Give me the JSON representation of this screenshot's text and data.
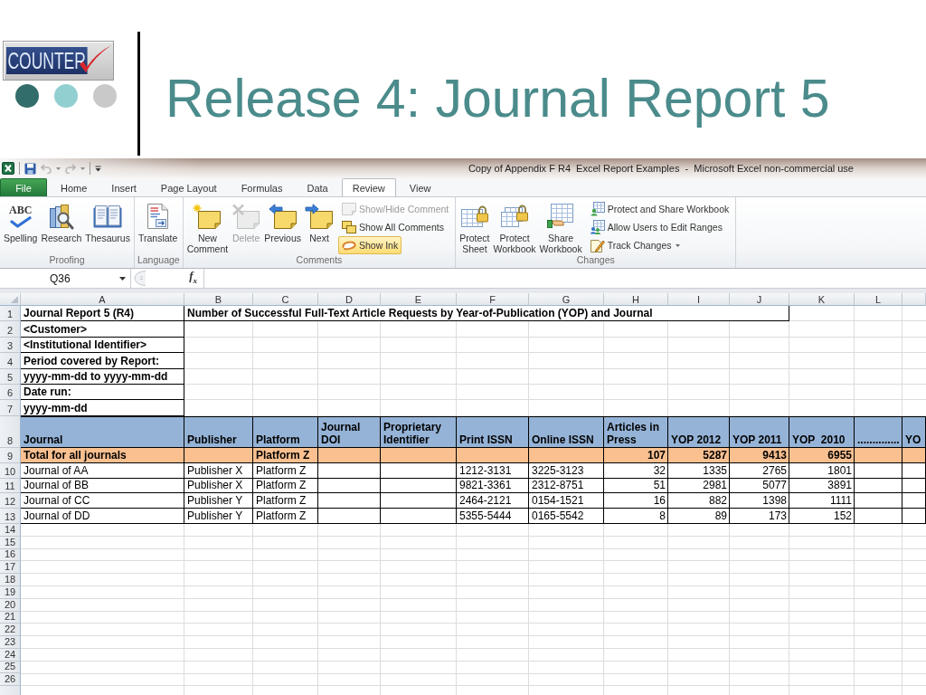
{
  "slide": {
    "logo": {
      "text": "COUNTER"
    },
    "title": "Release 4: Journal Report 5"
  },
  "window": {
    "title": "Copy of Appendix F R4  Excel Report Examples  -  Microsoft Excel non-commercial use"
  },
  "quick_access": {
    "undo": {
      "disabled": true
    },
    "redo": {
      "disabled": true
    }
  },
  "tabs": [
    {
      "label": "File",
      "kind": "file",
      "selected": false
    },
    {
      "label": "Home",
      "kind": "tab",
      "selected": false
    },
    {
      "label": "Insert",
      "kind": "tab",
      "selected": false
    },
    {
      "label": "Page Layout",
      "kind": "tab",
      "selected": false
    },
    {
      "label": "Formulas",
      "kind": "tab",
      "selected": false
    },
    {
      "label": "Data",
      "kind": "tab",
      "selected": false
    },
    {
      "label": "Review",
      "kind": "tab",
      "selected": true
    },
    {
      "label": "View",
      "kind": "tab",
      "selected": false
    }
  ],
  "ribbon": {
    "groups": [
      {
        "label": "Proofing",
        "large_buttons": [
          {
            "label": "Spelling",
            "icon_text": "ABC",
            "disabled": false
          },
          {
            "label": "Research",
            "disabled": false
          },
          {
            "label": "Thesaurus",
            "disabled": false
          }
        ]
      },
      {
        "label": "Language",
        "large_buttons": [
          {
            "label": "Translate",
            "disabled": false
          }
        ]
      },
      {
        "label": "Comments",
        "large_buttons": [
          {
            "label": "New Comment",
            "disabled": false
          },
          {
            "label": "Delete",
            "disabled": true
          },
          {
            "label": "Previous",
            "disabled": false
          },
          {
            "label": "Next",
            "disabled": false
          }
        ],
        "small_buttons": [
          {
            "label": "Show/Hide Comment",
            "disabled": true,
            "on": false,
            "dropdown": false
          },
          {
            "label": "Show All Comments",
            "disabled": false,
            "on": false,
            "dropdown": false
          },
          {
            "label": "Show Ink",
            "disabled": false,
            "on": true,
            "dropdown": false
          }
        ]
      },
      {
        "label": "Changes",
        "large_buttons": [
          {
            "label": "Protect Sheet",
            "disabled": false
          },
          {
            "label": "Protect Workbook",
            "disabled": false
          },
          {
            "label": "Share Workbook",
            "disabled": false
          }
        ],
        "small_buttons": [
          {
            "label": "Protect and Share Workbook",
            "disabled": false,
            "on": false,
            "dropdown": false
          },
          {
            "label": "Allow Users to Edit Ranges",
            "disabled": false,
            "on": false,
            "dropdown": false
          },
          {
            "label": "Track Changes",
            "disabled": false,
            "on": false,
            "dropdown": true
          }
        ]
      }
    ]
  },
  "formula_bar": {
    "name_box": "Q36",
    "function_button": "f$_{x}$"
  },
  "sheet": {
    "columns": [
      "A",
      "B",
      "C",
      "D",
      "E",
      "F",
      "G",
      "H",
      "I",
      "J",
      "K",
      "L"
    ],
    "info_rows": [
      {
        "number": "1",
        "text": "Journal Report 5 (R4)",
        "title": "Number of Successful Full-Text Article Requests by Year-of-Publication (YOP) and Journal"
      },
      {
        "number": "2",
        "text": "<Customer>"
      },
      {
        "number": "3",
        "text": "<Institutional Identifier>"
      },
      {
        "number": "4",
        "text": "Period covered by Report:"
      },
      {
        "number": "5",
        "text": "yyyy-mm-dd to yyyy-mm-dd"
      },
      {
        "number": "6",
        "text": "Date run:"
      },
      {
        "number": "7",
        "text": "yyyy-mm-dd"
      }
    ],
    "header_row": {
      "number": "8",
      "cells": [
        "Journal",
        "Publisher",
        "Platform",
        "Journal DOI",
        "Proprietary Identifier",
        "Print ISSN",
        "Online ISSN",
        "Articles in Press",
        "YOP 2012",
        "YOP 2011",
        "YOP  2010",
        "..............",
        "YO"
      ]
    },
    "total_row": {
      "number": "9",
      "journal": "Total for all journals",
      "platform": "Platform Z",
      "counts": [
        "107",
        "5287",
        "9413",
        "6955"
      ]
    },
    "journal_rows": [
      {
        "number": "10",
        "journal": "Journal of AA",
        "publisher": "Publisher X",
        "platform": "Platform Z",
        "print_issn": "1212-3131",
        "online_issn": "3225-3123",
        "counts": [
          "32",
          "1335",
          "2765",
          "1801"
        ]
      },
      {
        "number": "11",
        "journal": "Journal of BB",
        "publisher": "Publisher X",
        "platform": "Platform Z",
        "print_issn": "9821-3361",
        "online_issn": "2312-8751",
        "counts": [
          "51",
          "2981",
          "5077",
          "3891"
        ]
      },
      {
        "number": "12",
        "journal": "Journal of CC",
        "publisher": "Publisher Y",
        "platform": "Platform Z",
        "print_issn": "2464-2121",
        "online_issn": "0154-1521",
        "counts": [
          "16",
          "882",
          "1398",
          "1111"
        ]
      },
      {
        "number": "13",
        "journal": "Journal of DD",
        "publisher": "Publisher Y",
        "platform": "Platform Z",
        "print_issn": "5355-5444",
        "online_issn": "0165-5542",
        "counts": [
          "8",
          "89",
          "173",
          "152"
        ]
      }
    ],
    "empty_rows": [
      "14",
      "15",
      "16",
      "17",
      "18",
      "19",
      "20",
      "21",
      "22",
      "23",
      "24",
      "25",
      "26"
    ]
  }
}
